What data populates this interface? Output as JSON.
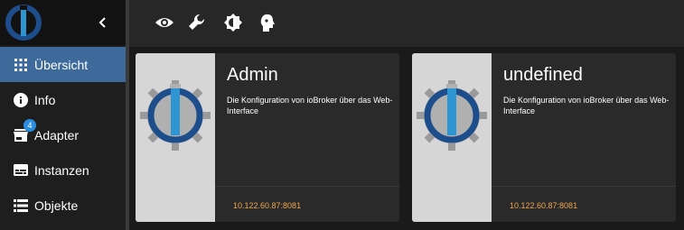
{
  "sidebar": {
    "items": [
      {
        "label": "Übersicht",
        "icon": "apps-icon",
        "active": true
      },
      {
        "label": "Info",
        "icon": "info-icon"
      },
      {
        "label": "Adapter",
        "icon": "store-icon",
        "badge": "4"
      },
      {
        "label": "Instanzen",
        "icon": "subtitles-icon"
      },
      {
        "label": "Objekte",
        "icon": "list-icon"
      }
    ]
  },
  "toolbar": {
    "icons": [
      "eye-icon",
      "wrench-icon",
      "brightness-icon",
      "face-icon"
    ]
  },
  "cards": [
    {
      "title": "Admin",
      "description": "Die Konfiguration von ioBroker über das Web-Interface",
      "link": "10.122.60.87:8081"
    },
    {
      "title": "undefined",
      "description": "Die Konfiguration von ioBroker über das Web-Interface",
      "link": "10.122.60.87:8081"
    }
  ],
  "colors": {
    "accent": "#3d6a9a",
    "badge": "#2b8de0",
    "link": "#f2a548",
    "logo_blue": "#1e4d8c",
    "logo_light": "#2e95d3"
  }
}
